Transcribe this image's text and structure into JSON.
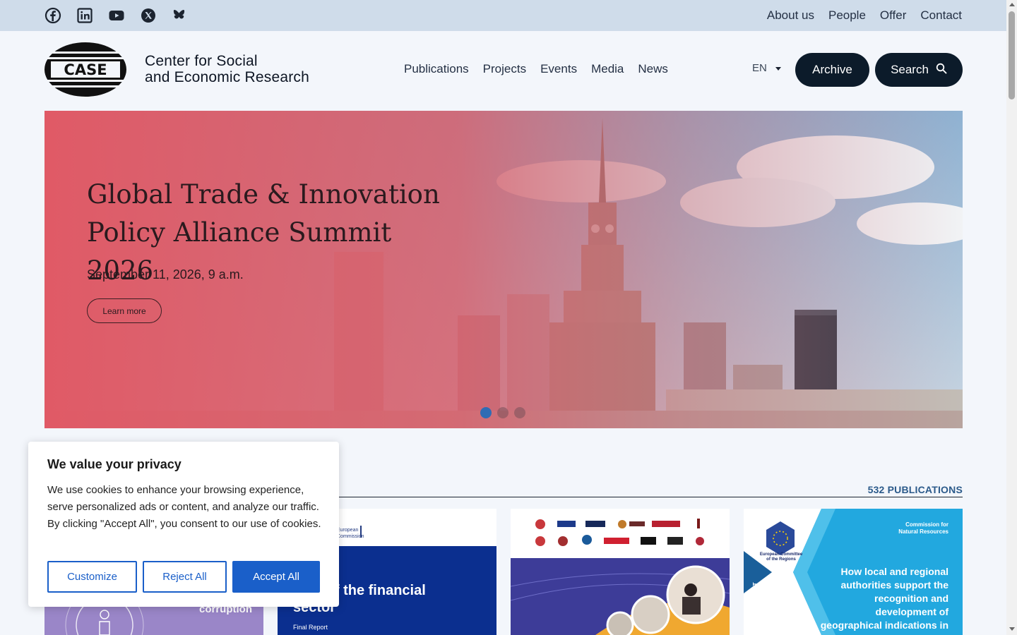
{
  "topbar": {
    "social_icons": [
      "facebook-icon",
      "linkedin-icon",
      "youtube-icon",
      "x-icon",
      "bluesky-icon"
    ],
    "links": [
      "About us",
      "People",
      "Offer",
      "Contact"
    ]
  },
  "header": {
    "logo_text": "CASE",
    "org_name_line1": "Center for Social",
    "org_name_line2": "and Economic Research",
    "nav": [
      "Publications",
      "Projects",
      "Events",
      "Media",
      "News"
    ],
    "language": "EN",
    "archive_label": "Archive",
    "search_label": "Search"
  },
  "hero": {
    "title_line1": "Global Trade & Innovation",
    "title_line2": "Policy Alliance Summit 2026",
    "date": "September 11, 2026, 9 a.m.",
    "cta_label": "Learn more",
    "slide_count": 3,
    "active_slide": 1
  },
  "publications": {
    "count_label": "532 PUBLICATIONS",
    "cards": [
      {
        "visible_text": "corruption"
      },
      {
        "header_label_line1": "European",
        "header_label_line2": "Commission",
        "title_line1": "...on of the financial",
        "title_line2": "sector",
        "subtitle": "Final Report"
      },
      {
        "visible_text": ""
      },
      {
        "committee_line1": "European Committee",
        "committee_line2": "of the Regions",
        "label_line1": "Commission for",
        "label_line2": "Natural Resources",
        "side_tag": "NAT",
        "title": "How local and regional authorities support the recognition and development of geographical indications in their territory"
      }
    ]
  },
  "cookie_banner": {
    "title": "We value your privacy",
    "body": "We use cookies to enhance your browsing experience, serve personalized ads or content, and analyze our traffic. By clicking \"Accept All\", you consent to our use of cookies.",
    "customize_label": "Customize",
    "reject_label": "Reject All",
    "accept_label": "Accept All"
  },
  "colors": {
    "topbar_bg": "#cfdcea",
    "page_bg": "#f3f6fb",
    "dark_button": "#0c1b2a",
    "hero_overlay": "#e05a66",
    "accent_blue": "#1a5fc9",
    "count_blue": "#2b5a8a"
  }
}
